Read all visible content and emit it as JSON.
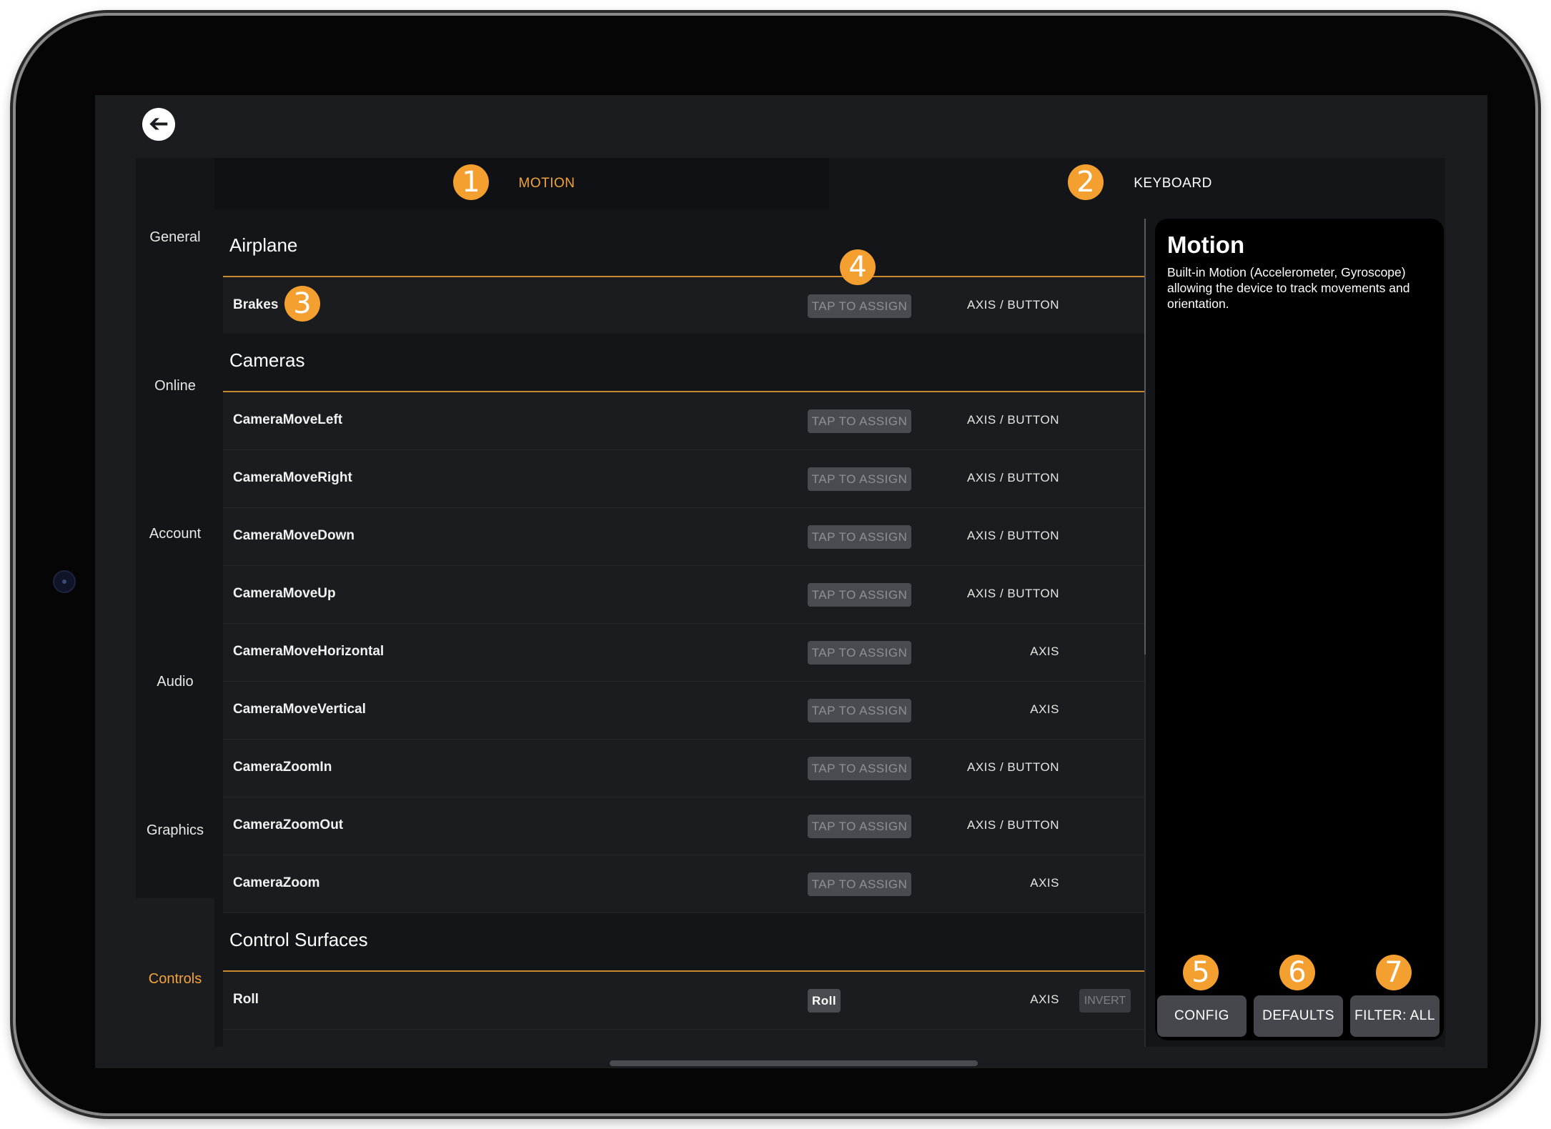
{
  "app": {
    "back_label": "➔"
  },
  "sidebar": {
    "items": [
      {
        "label": "General"
      },
      {
        "label": "Online"
      },
      {
        "label": "Account"
      },
      {
        "label": "Audio"
      },
      {
        "label": "Graphics"
      },
      {
        "label": "Controls"
      }
    ],
    "active": "Controls"
  },
  "tabs": [
    {
      "label": "MOTION",
      "badge": "1"
    },
    {
      "label": "KEYBOARD",
      "badge": "2"
    }
  ],
  "sections": [
    {
      "title": "Airplane",
      "rows": [
        {
          "name": "Brakes",
          "assign": "TAP TO ASSIGN",
          "type": "AXIS / BUTTON"
        }
      ]
    },
    {
      "title": "Cameras",
      "rows": [
        {
          "name": "CameraMoveLeft",
          "assign": "TAP TO ASSIGN",
          "type": "AXIS / BUTTON"
        },
        {
          "name": "CameraMoveRight",
          "assign": "TAP TO ASSIGN",
          "type": "AXIS / BUTTON"
        },
        {
          "name": "CameraMoveDown",
          "assign": "TAP TO ASSIGN",
          "type": "AXIS / BUTTON"
        },
        {
          "name": "CameraMoveUp",
          "assign": "TAP TO ASSIGN",
          "type": "AXIS / BUTTON"
        },
        {
          "name": "CameraMoveHorizontal",
          "assign": "TAP TO ASSIGN",
          "type": "AXIS"
        },
        {
          "name": "CameraMoveVertical",
          "assign": "TAP TO ASSIGN",
          "type": "AXIS"
        },
        {
          "name": "CameraZoomIn",
          "assign": "TAP TO ASSIGN",
          "type": "AXIS / BUTTON"
        },
        {
          "name": "CameraZoomOut",
          "assign": "TAP TO ASSIGN",
          "type": "AXIS / BUTTON"
        },
        {
          "name": "CameraZoom",
          "assign": "TAP TO ASSIGN",
          "type": "AXIS"
        }
      ]
    },
    {
      "title": "Control Surfaces",
      "rows": [
        {
          "name": "Roll",
          "assign": "Roll",
          "type": "AXIS",
          "invert": "INVERT"
        }
      ]
    }
  ],
  "row_badges": {
    "brakes": "3",
    "assign_column": "4"
  },
  "info": {
    "title": "Motion",
    "description": "Built-in Motion (Accelerometer, Gyroscope) allowing the device to track movements and orientation."
  },
  "actions": [
    {
      "label": "CONFIG",
      "badge": "5"
    },
    {
      "label": "DEFAULTS",
      "badge": "6"
    },
    {
      "label": "FILTER: ALL",
      "badge": "7"
    }
  ],
  "colors": {
    "accent": "#f3a33a",
    "badge": "#f4a030",
    "background": "#1b1c20",
    "panel": "#141518"
  }
}
